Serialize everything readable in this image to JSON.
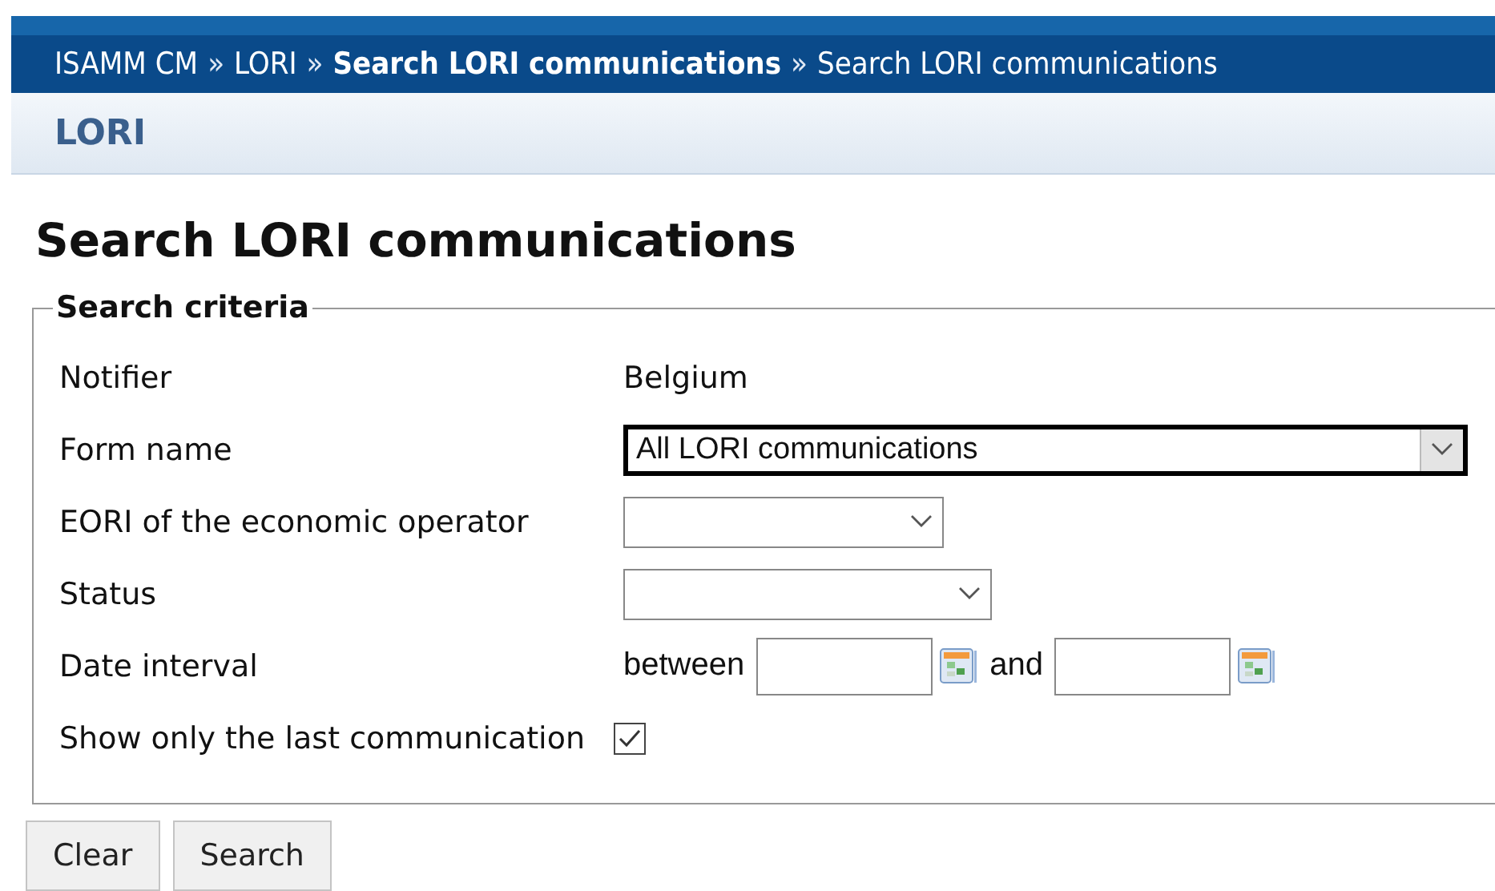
{
  "breadcrumb": [
    {
      "kind": "link",
      "label": "ISAMM CM",
      "bold": false
    },
    {
      "kind": "separator",
      "label": "»"
    },
    {
      "kind": "link",
      "label": "LORI",
      "bold": false
    },
    {
      "kind": "separator",
      "label": "»"
    },
    {
      "kind": "link",
      "label": "Search LORI communications",
      "bold": true
    },
    {
      "kind": "separator",
      "label": "»"
    },
    {
      "kind": "link",
      "label": "Search LORI communications",
      "bold": false
    }
  ],
  "section_title": "LORI",
  "page_title": "Search LORI communications",
  "criteria": {
    "legend": "Search criteria",
    "rows": [
      {
        "kind": "text",
        "label": "Notifier",
        "value": "Belgium"
      },
      {
        "kind": "select",
        "label": "Form name",
        "value": "All LORI communications",
        "focused": true
      },
      {
        "kind": "select",
        "label": "EORI of the economic operator",
        "focused": false
      },
      {
        "kind": "select",
        "label": "Status",
        "focused": false
      },
      {
        "kind": "date_range",
        "label": "Date interval",
        "from_label": "between",
        "to_label": "and"
      },
      {
        "kind": "checkbox",
        "label": "Show only the last communication",
        "checked": true
      }
    ]
  },
  "buttons": [
    "Clear",
    "Search"
  ]
}
